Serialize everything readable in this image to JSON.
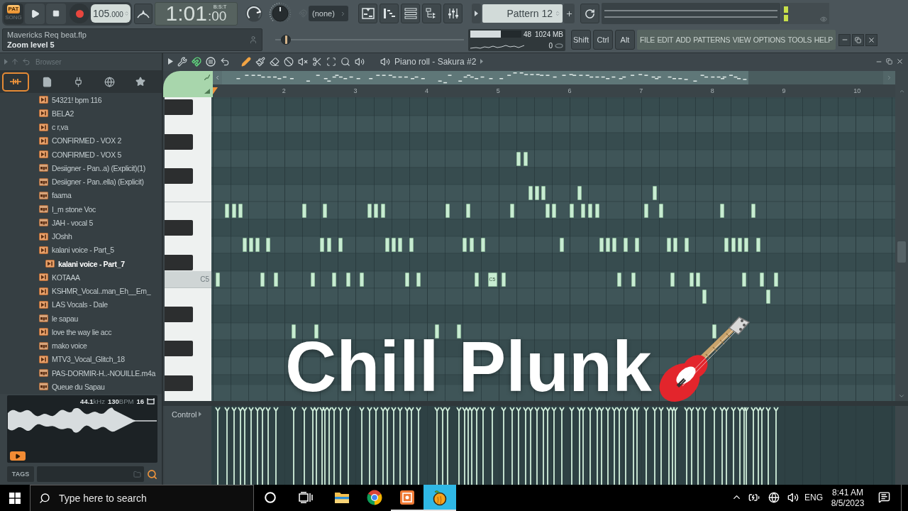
{
  "toolbar": {
    "mode": [
      {
        "label": "PAT",
        "selected": true
      },
      {
        "label": "SONG",
        "selected": false
      }
    ],
    "tempo": {
      "whole": "105",
      "fraction": ".000"
    },
    "time": {
      "main": "1:01",
      "sub": ":00",
      "unit": "B:S:T"
    },
    "knobs": [
      {
        "level": 0.78
      },
      {
        "level": 0.5
      }
    ],
    "snap": "(none)",
    "views": [
      {
        "kind": "playlist"
      },
      {
        "kind": "piano_roll"
      },
      {
        "kind": "channel_rack"
      },
      {
        "kind": "browser"
      },
      {
        "kind": "mixer"
      }
    ],
    "pattern": "Pattern 12",
    "hint": {
      "file": "Mavericks Req beat.flp",
      "message": "Zoom level 5"
    },
    "song_position": {
      "level": 0.03
    },
    "cpu": {
      "level": 0.6,
      "value": "48",
      "memory": "1024 MB",
      "polyphony": "0"
    },
    "modifiers": [
      "Shift",
      "Ctrl",
      "Alt"
    ],
    "menu": [
      "FILE",
      "EDIT",
      "ADD",
      "PATTERNS",
      "VIEW",
      "OPTIONS",
      "TOOLS",
      "HELP"
    ]
  },
  "browser": {
    "title": "Browser",
    "tabs": [
      {
        "kind": "all",
        "selected": true
      },
      {
        "kind": "files",
        "selected": false
      },
      {
        "kind": "plugins",
        "selected": false
      },
      {
        "kind": "online",
        "selected": false
      },
      {
        "kind": "starred",
        "selected": false
      }
    ],
    "items": [
      {
        "label": "54321! bpm 116",
        "kind": "wav",
        "selected": false
      },
      {
        "label": "BELA2",
        "kind": "wav",
        "selected": false
      },
      {
        "label": "c r,va",
        "kind": "wav",
        "selected": false
      },
      {
        "label": "CONFIRMED - VOX 2",
        "kind": "wav",
        "selected": false
      },
      {
        "label": "CONFIRMED - VOX 5",
        "kind": "wav",
        "selected": false
      },
      {
        "label": "Desiigner - Pan..a) (Explicit)(1)",
        "kind": "mp3",
        "selected": false
      },
      {
        "label": "Desiigner - Pan..ella) (Explicit)",
        "kind": "mp3",
        "selected": false
      },
      {
        "label": "faama",
        "kind": "mp3",
        "selected": false
      },
      {
        "label": "I_m stone Voc",
        "kind": "mp3",
        "selected": false
      },
      {
        "label": "JAH - vocal 5",
        "kind": "mp3",
        "selected": false
      },
      {
        "label": "JOshh",
        "kind": "wav",
        "selected": false
      },
      {
        "label": "kalani voice - Part_5",
        "kind": "wav",
        "selected": false
      },
      {
        "label": "kalani voice - Part_7",
        "kind": "wav",
        "selected": true
      },
      {
        "label": "KOTAAA",
        "kind": "wav",
        "selected": false
      },
      {
        "label": "KSHMR_Vocal..man_Eh__Em_",
        "kind": "wav",
        "selected": false
      },
      {
        "label": "LAS Vocals - Dale",
        "kind": "wav",
        "selected": false
      },
      {
        "label": "le sapau",
        "kind": "mp3",
        "selected": false
      },
      {
        "label": "love the way lie acc",
        "kind": "wav",
        "selected": false
      },
      {
        "label": "mako voice",
        "kind": "mp3",
        "selected": false
      },
      {
        "label": "MTV3_Vocal_Glitch_18",
        "kind": "wav",
        "selected": false
      },
      {
        "label": "PAS-DORMIR-H..-NOUILLE.m4a",
        "kind": "mp3",
        "selected": false
      },
      {
        "label": "Queue du Sapau",
        "kind": "mp3",
        "selected": false
      }
    ],
    "preview": {
      "rate": "44.1",
      "rate_unit": "kHz",
      "tempo": "130",
      "tempo_unit": "BPM",
      "bits": "16"
    },
    "tags": "TAGS"
  },
  "piano_roll": {
    "title": "Piano roll - Sakura #2",
    "controls": [
      {
        "kind": "arrow",
        "on": false
      },
      {
        "kind": "wrench",
        "on": false
      },
      {
        "kind": "snap",
        "on": true
      },
      {
        "kind": "stamp",
        "on": false
      },
      {
        "kind": "undo",
        "on": false
      }
    ],
    "tools": [
      {
        "kind": "draw",
        "selected": true
      },
      {
        "kind": "paint",
        "selected": false
      },
      {
        "kind": "delete",
        "selected": false
      },
      {
        "kind": "mute",
        "selected": false
      },
      {
        "kind": "slip",
        "selected": false
      },
      {
        "kind": "slice",
        "selected": false
      },
      {
        "kind": "select",
        "selected": false
      },
      {
        "kind": "zoom",
        "selected": false
      },
      {
        "kind": "playback",
        "selected": false
      }
    ],
    "ruler": [
      "2",
      "3",
      "4",
      "5",
      "6",
      "7",
      "8",
      "9",
      "10"
    ],
    "key_label": "C5",
    "note_label": "C5",
    "control_label": "Control"
  },
  "overlay": {
    "title": "Chill Plunk"
  },
  "taskbar": {
    "search_placeholder": "Type here to search",
    "apps": [
      {
        "kind": "file_explorer",
        "running": false,
        "selected": false
      },
      {
        "kind": "web_browser",
        "running": false,
        "selected": false
      },
      {
        "kind": "recorder",
        "running": true,
        "selected": false
      },
      {
        "kind": "music_app",
        "running": true,
        "selected": true
      }
    ],
    "language": "ENG",
    "time": "8:41 AM",
    "date": "8/5/2023"
  }
}
